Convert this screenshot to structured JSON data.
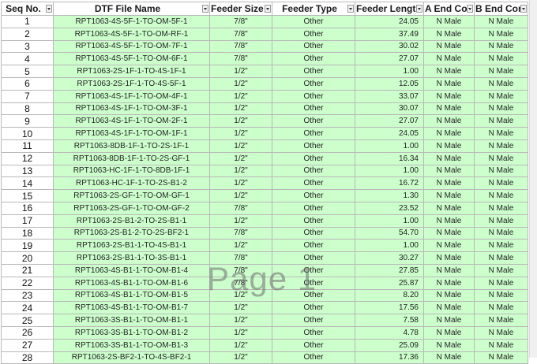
{
  "columns": {
    "seq": "Seq No.",
    "dtf": "DTF File Name",
    "size": "Feeder Size",
    "type": "Feeder Type",
    "length": "Feeder Length",
    "a_end": "A End Cor",
    "b_end": "B End Con"
  },
  "rows": [
    {
      "seq": "1",
      "dtf": "RPT1063-4S-5F-1-TO-OM-5F-1",
      "size": "7/8\"",
      "type": "Other",
      "length": "24.05",
      "a_end": "N Male",
      "b_end": "N Male"
    },
    {
      "seq": "2",
      "dtf": "RPT1063-4S-5F-1-TO-OM-RF-1",
      "size": "7/8\"",
      "type": "Other",
      "length": "37.49",
      "a_end": "N Male",
      "b_end": "N Male"
    },
    {
      "seq": "3",
      "dtf": "RPT1063-4S-5F-1-TO-OM-7F-1",
      "size": "7/8\"",
      "type": "Other",
      "length": "30.02",
      "a_end": "N Male",
      "b_end": "N Male"
    },
    {
      "seq": "4",
      "dtf": "RPT1063-4S-5F-1-TO-OM-6F-1",
      "size": "7/8\"",
      "type": "Other",
      "length": "27.07",
      "a_end": "N Male",
      "b_end": "N Male"
    },
    {
      "seq": "5",
      "dtf": "RPT1063-2S-1F-1-TO-4S-1F-1",
      "size": "1/2\"",
      "type": "Other",
      "length": "1.00",
      "a_end": "N Male",
      "b_end": "N Male"
    },
    {
      "seq": "6",
      "dtf": "RPT1063-2S-1F-1-TO-4S-5F-1",
      "size": "1/2\"",
      "type": "Other",
      "length": "12.05",
      "a_end": "N Male",
      "b_end": "N Male"
    },
    {
      "seq": "7",
      "dtf": "RPT1063-4S-1F-1-TO-OM-4F-1",
      "size": "1/2\"",
      "type": "Other",
      "length": "33.07",
      "a_end": "N Male",
      "b_end": "N Male"
    },
    {
      "seq": "8",
      "dtf": "RPT1063-4S-1F-1-TO-OM-3F-1",
      "size": "1/2\"",
      "type": "Other",
      "length": "30.07",
      "a_end": "N Male",
      "b_end": "N Male"
    },
    {
      "seq": "9",
      "dtf": "RPT1063-4S-1F-1-TO-OM-2F-1",
      "size": "1/2\"",
      "type": "Other",
      "length": "27.07",
      "a_end": "N Male",
      "b_end": "N Male"
    },
    {
      "seq": "10",
      "dtf": "RPT1063-4S-1F-1-TO-OM-1F-1",
      "size": "1/2\"",
      "type": "Other",
      "length": "24.05",
      "a_end": "N Male",
      "b_end": "N Male"
    },
    {
      "seq": "11",
      "dtf": "RPT1063-8DB-1F-1-TO-2S-1F-1",
      "size": "1/2\"",
      "type": "Other",
      "length": "1.00",
      "a_end": "N Male",
      "b_end": "N Male"
    },
    {
      "seq": "12",
      "dtf": "RPT1063-8DB-1F-1-TO-2S-GF-1",
      "size": "1/2\"",
      "type": "Other",
      "length": "16.34",
      "a_end": "N Male",
      "b_end": "N Male"
    },
    {
      "seq": "13",
      "dtf": "RPT1063-HC-1F-1-TO-8DB-1F-1",
      "size": "1/2\"",
      "type": "Other",
      "length": "1.00",
      "a_end": "N Male",
      "b_end": "N Male"
    },
    {
      "seq": "14",
      "dtf": "RPT1063-HC-1F-1-TO-2S-B1-2",
      "size": "1/2\"",
      "type": "Other",
      "length": "16.72",
      "a_end": "N Male",
      "b_end": "N Male"
    },
    {
      "seq": "15",
      "dtf": "RPT1063-2S-GF-1-TO-OM-GF-1",
      "size": "1/2\"",
      "type": "Other",
      "length": "1.30",
      "a_end": "N Male",
      "b_end": "N Male"
    },
    {
      "seq": "16",
      "dtf": "RPT1063-2S-GF-1-TO-OM-GF-2",
      "size": "7/8\"",
      "type": "Other",
      "length": "23.52",
      "a_end": "N Male",
      "b_end": "N Male"
    },
    {
      "seq": "17",
      "dtf": "RPT1063-2S-B1-2-TO-2S-B1-1",
      "size": "1/2\"",
      "type": "Other",
      "length": "1.00",
      "a_end": "N Male",
      "b_end": "N Male"
    },
    {
      "seq": "18",
      "dtf": "RPT1063-2S-B1-2-TO-2S-BF2-1",
      "size": "7/8\"",
      "type": "Other",
      "length": "54.70",
      "a_end": "N Male",
      "b_end": "N Male"
    },
    {
      "seq": "19",
      "dtf": "RPT1063-2S-B1-1-TO-4S-B1-1",
      "size": "1/2\"",
      "type": "Other",
      "length": "1.00",
      "a_end": "N Male",
      "b_end": "N Male"
    },
    {
      "seq": "20",
      "dtf": "RPT1063-2S-B1-1-TO-3S-B1-1",
      "size": "7/8\"",
      "type": "Other",
      "length": "30.27",
      "a_end": "N Male",
      "b_end": "N Male"
    },
    {
      "seq": "21",
      "dtf": "RPT1063-4S-B1-1-TO-OM-B1-4",
      "size": "7/8\"",
      "type": "Other",
      "length": "27.85",
      "a_end": "N Male",
      "b_end": "N Male"
    },
    {
      "seq": "22",
      "dtf": "RPT1063-4S-B1-1-TO-OM-B1-6",
      "size": "7/8\"",
      "type": "Other",
      "length": "25.87",
      "a_end": "N Male",
      "b_end": "N Male"
    },
    {
      "seq": "23",
      "dtf": "RPT1063-4S-B1-1-TO-OM-B1-5",
      "size": "1/2\"",
      "type": "Other",
      "length": "8.20",
      "a_end": "N Male",
      "b_end": "N Male"
    },
    {
      "seq": "24",
      "dtf": "RPT1063-4S-B1-1-TO-OM-B1-7",
      "size": "1/2\"",
      "type": "Other",
      "length": "17.56",
      "a_end": "N Male",
      "b_end": "N Male"
    },
    {
      "seq": "25",
      "dtf": "RPT1063-3S-B1-1-TO-OM-B1-1",
      "size": "1/2\"",
      "type": "Other",
      "length": "7.58",
      "a_end": "N Male",
      "b_end": "N Male"
    },
    {
      "seq": "26",
      "dtf": "RPT1063-3S-B1-1-TO-OM-B1-2",
      "size": "1/2\"",
      "type": "Other",
      "length": "4.78",
      "a_end": "N Male",
      "b_end": "N Male"
    },
    {
      "seq": "27",
      "dtf": "RPT1063-3S-B1-1-TO-OM-B1-3",
      "size": "1/2\"",
      "type": "Other",
      "length": "25.09",
      "a_end": "N Male",
      "b_end": "N Male"
    },
    {
      "seq": "28",
      "dtf": "RPT1063-2S-BF2-1-TO-4S-BF2-1",
      "size": "1/2\"",
      "type": "Other",
      "length": "17.36",
      "a_end": "N Male",
      "b_end": "N Male"
    }
  ],
  "watermark": "Page 1",
  "colors": {
    "cell_fill": "#ccffcc",
    "grid": "#b8b8b8",
    "header_bg": "#ffffff"
  }
}
